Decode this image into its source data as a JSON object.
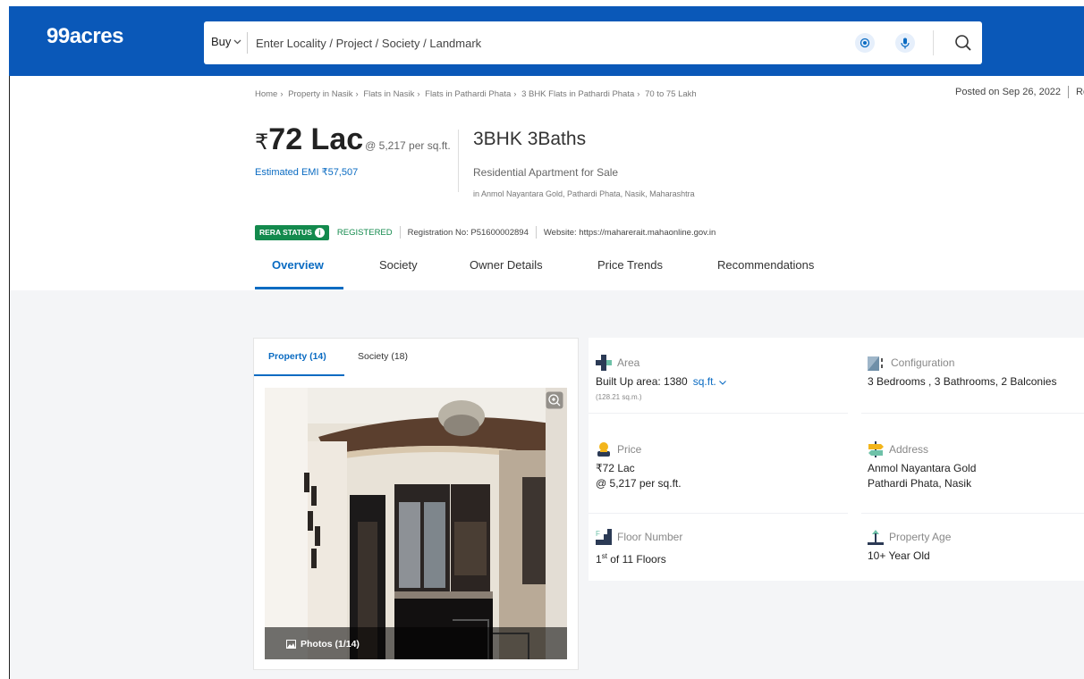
{
  "header": {
    "logo": "99acres",
    "buy_label": "Buy",
    "search_placeholder": "Enter Locality / Project / Society / Landmark"
  },
  "breadcrumb": [
    "Home",
    "Property in Nasik",
    "Flats in Nasik",
    "Flats in Pathardi Phata",
    "3 BHK Flats in Pathardi Phata",
    "70 to 75 Lakh"
  ],
  "posted": {
    "text": "Posted on Sep 26, 2022",
    "extra": "Re"
  },
  "listing": {
    "rupee": "₹",
    "price": "72 Lac",
    "per_sqft": "@ 5,217 per sq.ft.",
    "emi": "Estimated EMI ₹57,507",
    "config": "3BHK 3Baths",
    "type": "Residential Apartment for Sale",
    "location": "in Anmol Nayantara Gold, Pathardi Phata, Nasik, Maharashtra"
  },
  "rera": {
    "badge": "RERA STATUS",
    "status": "REGISTERED",
    "reg_no": "Registration No: P51600002894",
    "website": "Website: https://maharerait.mahaonline.gov.in"
  },
  "tabs": [
    "Overview",
    "Society",
    "Owner Details",
    "Price Trends",
    "Recommendations"
  ],
  "photo_tabs": [
    "Property (14)",
    "Society (18)"
  ],
  "photos_label": "Photos (1/14)",
  "details": {
    "area": {
      "label": "Area",
      "value": "Built Up area: 1380",
      "unit": "sq.ft.",
      "sub": "(128.21 sq.m.)"
    },
    "configuration": {
      "label": "Configuration",
      "value": "3 Bedrooms , 3 Bathrooms, 2 Balconies"
    },
    "price": {
      "label": "Price",
      "value": "₹72 Lac",
      "value2": "@ 5,217 per sq.ft."
    },
    "address": {
      "label": "Address",
      "value": "Anmol Nayantara Gold",
      "value2": "Pathardi Phata, Nasik"
    },
    "floor": {
      "label": "Floor Number",
      "value_num": "1",
      "value_sup": "st",
      "value_rest": " of 11 Floors"
    },
    "age": {
      "label": "Property Age",
      "value": "10+ Year Old"
    }
  },
  "colors": {
    "brand": "#0a58b8",
    "accent": "#0a6bc2",
    "rera_green": "#138a4d"
  }
}
